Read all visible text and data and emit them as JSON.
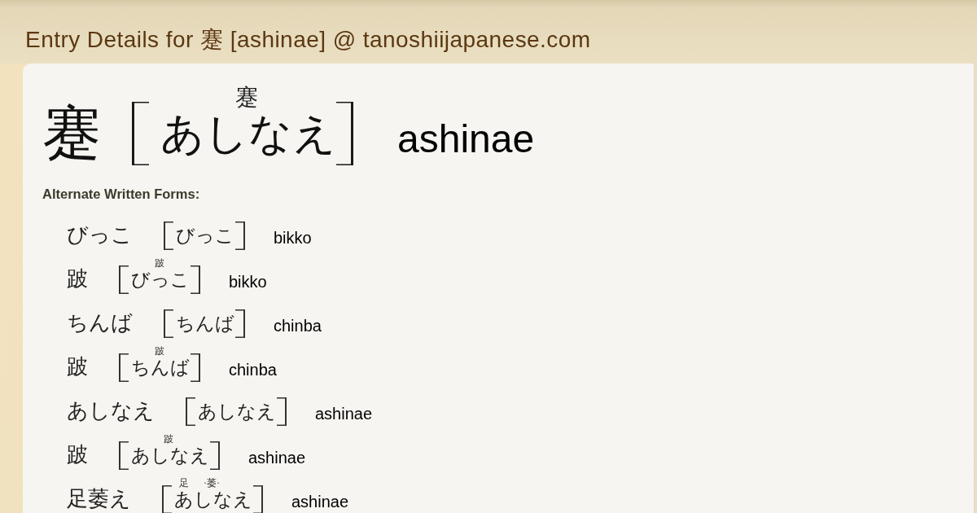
{
  "page_title": "Entry Details for 蹇 [ashinae] @ tanoshiijapanese.com",
  "entry": {
    "written": "蹇",
    "reading": [
      {
        "kana": "あしなえ",
        "ruby": "蹇"
      }
    ],
    "romaji": "ashinae"
  },
  "alternate_forms": {
    "heading": "Alternate Written Forms:",
    "items": [
      {
        "written": "びっこ",
        "reading": [
          {
            "kana": "びっこ"
          }
        ],
        "romaji": "bikko"
      },
      {
        "written": "跛",
        "reading": [
          {
            "kana": "びっこ",
            "ruby": "跛"
          }
        ],
        "romaji": "bikko"
      },
      {
        "written": "ちんば",
        "reading": [
          {
            "kana": "ちんば"
          }
        ],
        "romaji": "chinba"
      },
      {
        "written": "跛",
        "reading": [
          {
            "kana": "ちんば",
            "ruby": "跛"
          }
        ],
        "romaji": "chinba"
      },
      {
        "written": "あしなえ",
        "reading": [
          {
            "kana": "あしなえ"
          }
        ],
        "romaji": "ashinae"
      },
      {
        "written": "跛",
        "reading": [
          {
            "kana": "あしなえ",
            "ruby": "跛"
          }
        ],
        "romaji": "ashinae"
      },
      {
        "written": "足萎え",
        "reading": [
          {
            "kana": "あ",
            "ruby": "足"
          },
          {
            "kana": "しな",
            "ruby": "·萎·"
          },
          {
            "kana": "え"
          }
        ],
        "romaji": "ashinae"
      }
    ]
  }
}
